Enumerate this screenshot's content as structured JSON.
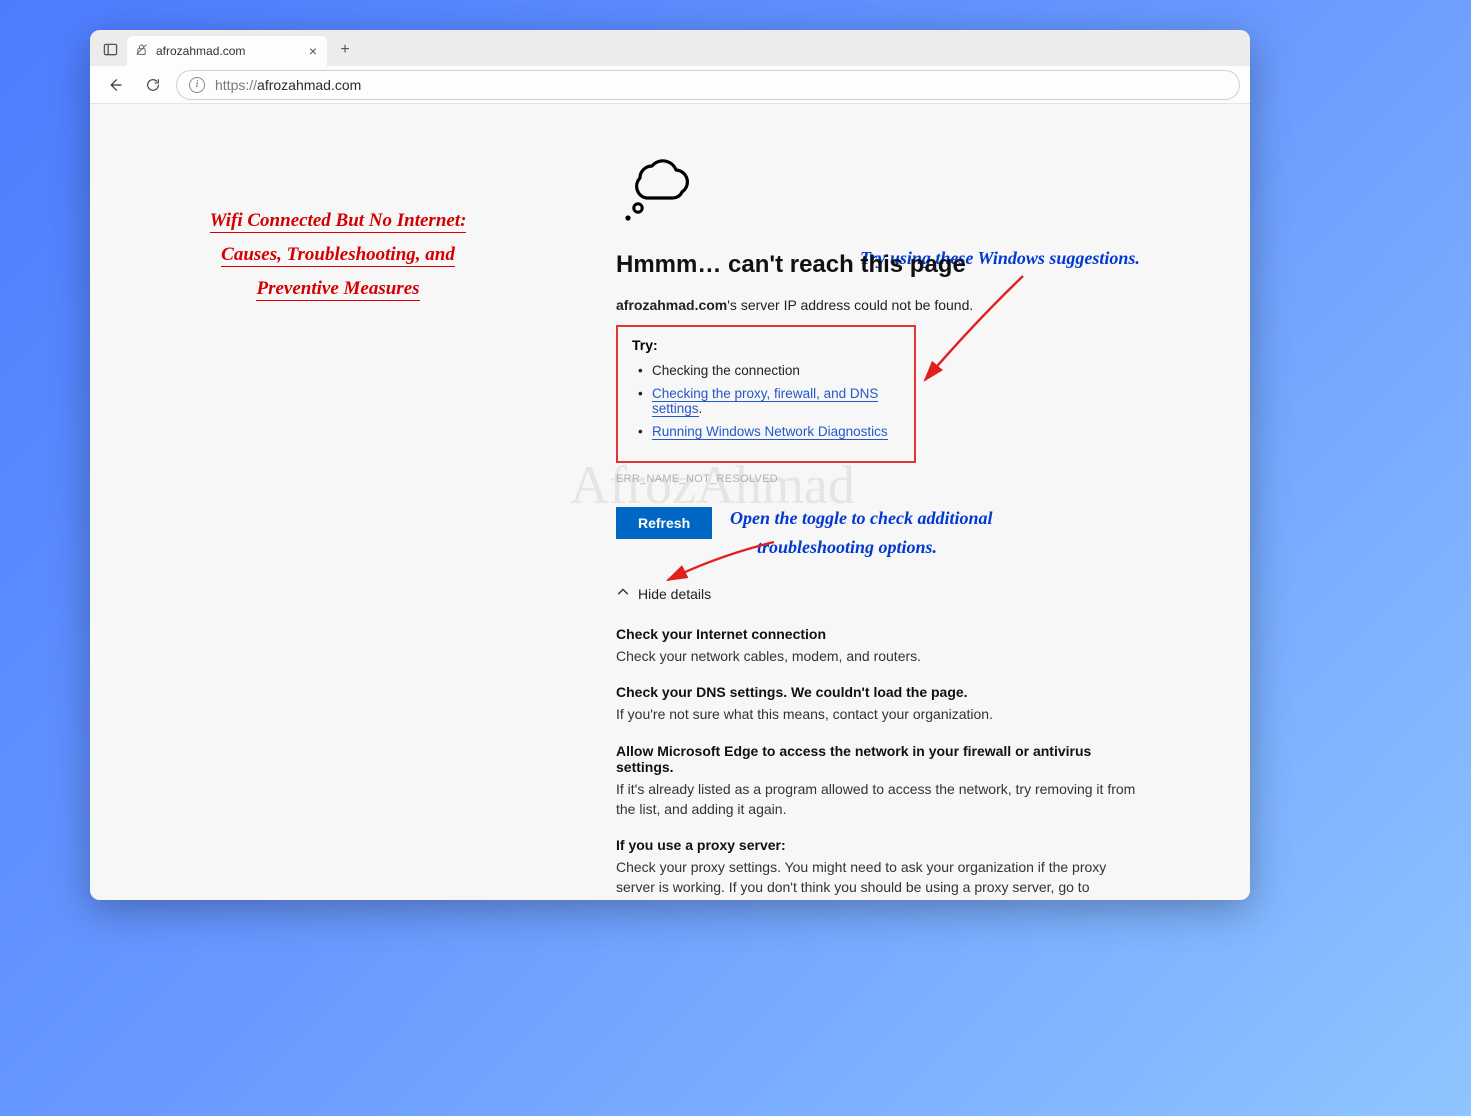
{
  "tab": {
    "title": "afrozahmad.com"
  },
  "toolbar": {
    "url_prefix": "https://",
    "url_host": "afrozahmad.com"
  },
  "annotations": {
    "title_l1": "Wifi Connected But No Internet:",
    "title_l2": "Causes, Troubleshooting, and",
    "title_l3": "Preventive Measures",
    "tip1": "Try using these Windows suggestions.",
    "tip2_l1": "Open the toggle to check additional",
    "tip2_l2": "troubleshooting options."
  },
  "error": {
    "heading": "Hmmm… can't reach this page",
    "host": "afrozahmad.com",
    "msg_tail": "'s server IP address could not be found.",
    "try_label": "Try:",
    "try_items": {
      "a": "Checking the connection",
      "b": "Checking the proxy, firewall, and DNS settings",
      "c": "Running Windows Network Diagnostics"
    },
    "code": "ERR_NAME_NOT_RESOLVED",
    "refresh": "Refresh",
    "toggle": "Hide details",
    "details": {
      "d1h": "Check your Internet connection",
      "d1p": "Check your network cables, modem, and routers.",
      "d2h": "Check your DNS settings. We couldn't load the page.",
      "d2p": "If you're not sure what this means, contact your organization.",
      "d3h": "Allow Microsoft Edge to access the network in your firewall or antivirus settings.",
      "d3p": "If it's already listed as a program allowed to access the network, try removing it from the list, and adding it again.",
      "d4h": "If you use a proxy server:",
      "d4p": "Check your proxy settings. You might need to ask your organization if the proxy server is working. If you don't think you should be using a proxy server, go to Settings > System > Open your computer's proxy settings"
    }
  },
  "watermark": "AfrozAhmad"
}
